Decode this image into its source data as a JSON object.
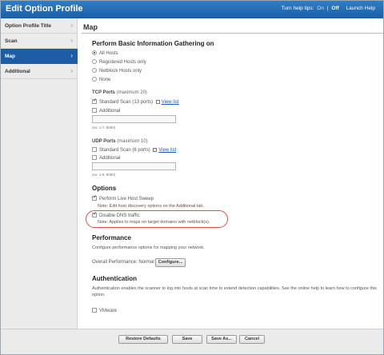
{
  "titlebar": {
    "title": "Edit Option Profile",
    "help_tips_label": "Turn help tips:",
    "help_on": "On",
    "help_sep": "|",
    "help_off": "Off",
    "launch_help": "Launch Help"
  },
  "sidebar": {
    "items": [
      {
        "label": "Option Profile Title"
      },
      {
        "label": "Scan"
      },
      {
        "label": "Map",
        "active": true
      },
      {
        "label": "Additional"
      }
    ]
  },
  "main": {
    "page_title": "Map",
    "basic_info": {
      "heading": "Perform Basic Information Gathering on",
      "options": [
        "All Hosts",
        "Registered Hosts only",
        "Netblock Hosts only",
        "None"
      ],
      "selected": "All Hosts"
    },
    "tcp": {
      "heading": "TCP Ports",
      "max": "(maximum 20)",
      "standard_label": "Standard Scan (13 ports)",
      "standard_checked": true,
      "view_list": "View list",
      "additional_label": "Additional",
      "additional_checked": false,
      "input_value": "",
      "hint": "(ex: 1-7, 8080)"
    },
    "udp": {
      "heading": "UDP Ports",
      "max": "(maximum 10)",
      "standard_label": "Standard Scan (6 ports)",
      "standard_checked": false,
      "view_list": "View list",
      "additional_label": "Additional",
      "additional_checked": false,
      "input_value": "",
      "hint": "(ex: 1-9, 8080)"
    },
    "options": {
      "heading": "Options",
      "live_sweep_label": "Perform Live Host Sweep",
      "live_sweep_checked": true,
      "live_sweep_note": "Note: Edit host discovery options on the Additional tab.",
      "disable_dns_label": "Disable DNS traffic",
      "disable_dns_checked": true,
      "disable_dns_note": "Note: Applies to maps on target domains with netblock(s)."
    },
    "performance": {
      "heading": "Performance",
      "description": "Configure performance options for mapping your network.",
      "overall_label": "Overall Performance: Normal",
      "configure_button": "Configure..."
    },
    "authentication": {
      "heading": "Authentication",
      "description": "Authentication enables the scanner to log into hosts at scan time to extend detection capabilities. See the online help to learn how to configure this option.",
      "vmware_label": "VMware",
      "vmware_checked": false
    }
  },
  "footer": {
    "restore_defaults": "Restore Defaults",
    "save": "Save",
    "save_as": "Save As...",
    "cancel": "Cancel"
  },
  "colors": {
    "titlebar": "#1f66ad",
    "nav_active": "#1c5da6",
    "highlight_ring": "#d9534f"
  }
}
